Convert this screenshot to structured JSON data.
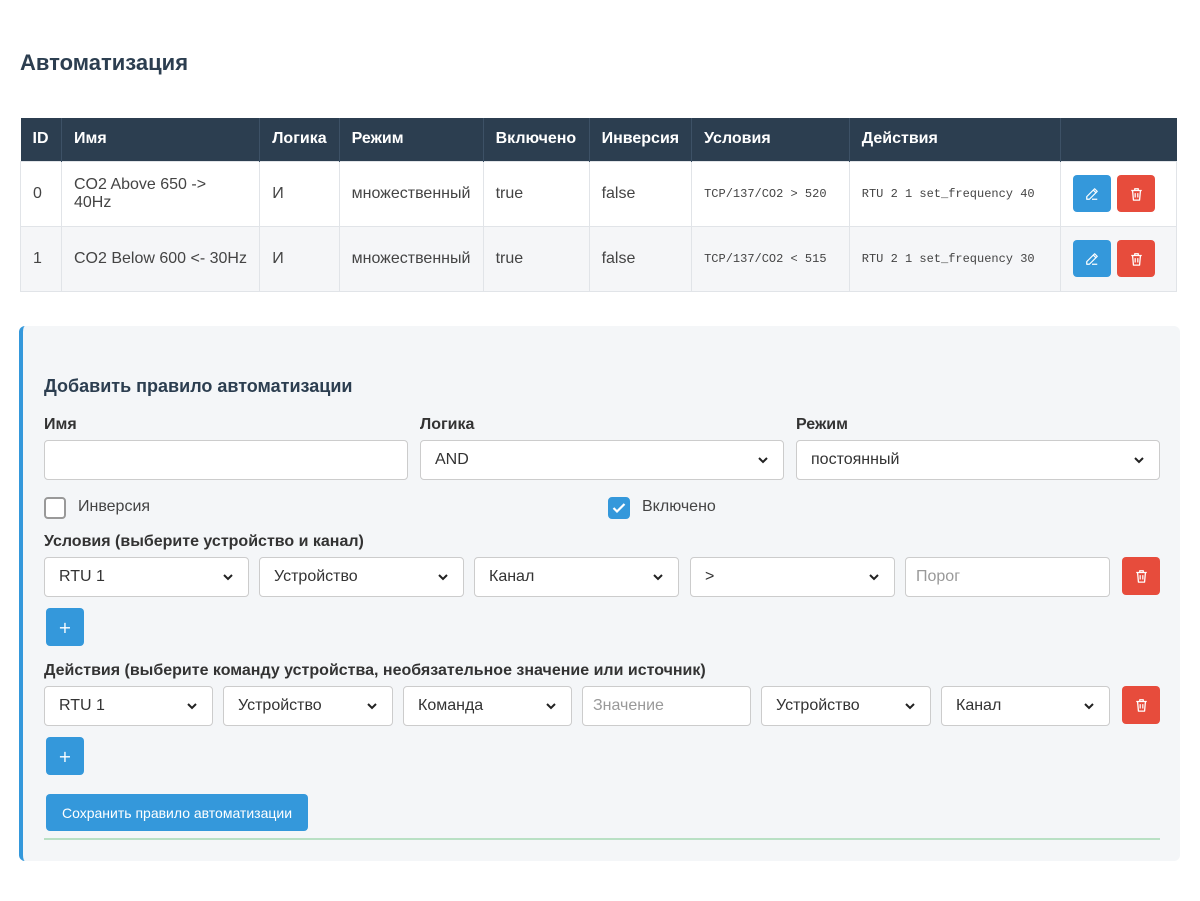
{
  "page": {
    "title": "Автоматизация"
  },
  "table": {
    "headers": [
      "ID",
      "Имя",
      "Логика",
      "Режим",
      "Включено",
      "Инверсия",
      "Условия",
      "Действия",
      ""
    ],
    "rows": [
      {
        "id": "0",
        "name": "CO2 Above 650 -> 40Hz",
        "logic": "И",
        "mode": "множественный",
        "enabled": "true",
        "inverse": "false",
        "conditions": "TCP/137/CO2 > 520",
        "actions": "RTU 2 1 set_frequency 40"
      },
      {
        "id": "1",
        "name": "CO2 Below 600 <- 30Hz",
        "logic": "И",
        "mode": "множественный",
        "enabled": "true",
        "inverse": "false",
        "conditions": "TCP/137/CO2 < 515",
        "actions": "RTU 2 1 set_frequency 30"
      }
    ],
    "edit_icon": "pencil-icon",
    "delete_icon": "trash-icon"
  },
  "form": {
    "title": "Добавить правило автоматизации",
    "name_label": "Имя",
    "name_value": "",
    "logic_label": "Логика",
    "logic_value": "AND",
    "mode_label": "Режим",
    "mode_value": "постоянный",
    "inverse_label": "Инверсия",
    "inverse_checked": false,
    "enabled_label": "Включено",
    "enabled_checked": true,
    "conditions_label": "Условия (выберите устройство и канал)",
    "condition": {
      "source": "RTU 1",
      "device": "Устройство",
      "channel": "Канал",
      "operator": ">",
      "threshold_placeholder": "Порог"
    },
    "add_symbol": "+",
    "actions_label": "Действия (выберите команду устройства, необязательное значение или источник)",
    "action": {
      "source": "RTU 1",
      "device": "Устройство",
      "command": "Команда",
      "value_placeholder": "Значение",
      "src_device": "Устройство",
      "src_channel": "Канал"
    },
    "save_label": "Сохранить правило автоматизации"
  },
  "colors": {
    "header": "#2c3e50",
    "accent": "#3498db",
    "danger": "#e74c3c"
  }
}
